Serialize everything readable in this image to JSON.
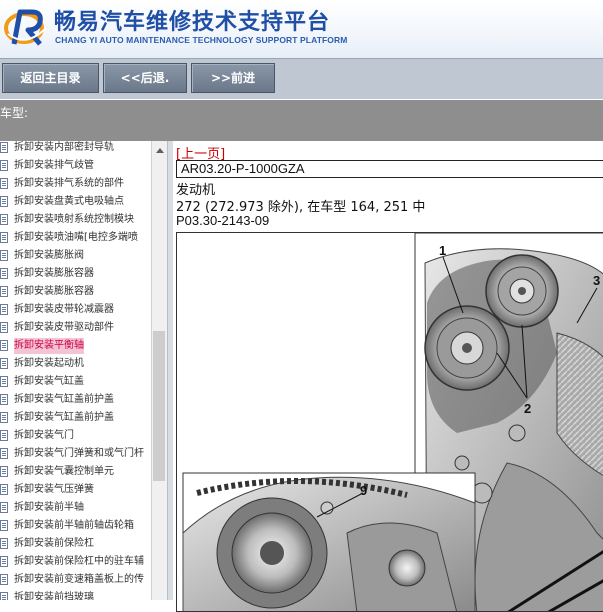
{
  "header": {
    "title_cn": "畅易汽车维修技术支持平台",
    "title_en": "CHANG YI AUTO MAINTENANCE TECHNOLOGY SUPPORT PLATFORM"
  },
  "toolbar": {
    "home_label": "返回主目录",
    "back_label": "<<后退.",
    "forward_label": ">>前进"
  },
  "model_bar": {
    "label": "车型:"
  },
  "tree": {
    "items": [
      {
        "label": "拆卸安装内部密封导轨",
        "selected": false
      },
      {
        "label": "拆卸安装排气歧管",
        "selected": false
      },
      {
        "label": "拆卸安装排气系统的部件",
        "selected": false
      },
      {
        "label": "拆卸安装盘黄式电吸轴点",
        "selected": false
      },
      {
        "label": "拆卸安装喷射系统控制模块",
        "selected": false
      },
      {
        "label": "拆卸安装喷油嘴[电控多端喷",
        "selected": false
      },
      {
        "label": "拆卸安装膨胀阀",
        "selected": false
      },
      {
        "label": "拆卸安装膨胀容器",
        "selected": false
      },
      {
        "label": "拆卸安装膨胀容器",
        "selected": false
      },
      {
        "label": "拆卸安装皮带轮减震器",
        "selected": false
      },
      {
        "label": "拆卸安装皮带驱动部件",
        "selected": false
      },
      {
        "label": "拆卸安装平衡轴",
        "selected": true
      },
      {
        "label": "拆卸安装起动机",
        "selected": false
      },
      {
        "label": "拆卸安装气缸盖",
        "selected": false
      },
      {
        "label": "拆卸安装气缸盖前护盖",
        "selected": false
      },
      {
        "label": "拆卸安装气缸盖前护盖",
        "selected": false
      },
      {
        "label": "拆卸安装气门",
        "selected": false
      },
      {
        "label": "拆卸安装气门弹簧和或气门杆",
        "selected": false
      },
      {
        "label": "拆卸安装气囊控制单元",
        "selected": false
      },
      {
        "label": "拆卸安装气压弹簧",
        "selected": false
      },
      {
        "label": "拆卸安装前半轴",
        "selected": false
      },
      {
        "label": "拆卸安装前半轴前轴齿轮箱",
        "selected": false
      },
      {
        "label": "拆卸安装前保险杠",
        "selected": false
      },
      {
        "label": "拆卸安装前保险杠中的驻车辅",
        "selected": false
      },
      {
        "label": "拆卸安装前变速箱盖板上的传",
        "selected": false
      },
      {
        "label": "拆卸安装前挡玻璃",
        "selected": false
      }
    ]
  },
  "content": {
    "prev_link": "[上一页]",
    "doc_code": "AR03.20-P-1000GZA",
    "section": "发动机",
    "note": "272 (272.973 除外), 在车型 164, 251 中",
    "figure_code": "P03.30-2143-09",
    "callouts": [
      "1",
      "2",
      "3",
      "9"
    ]
  },
  "colors": {
    "title_blue": "#1f4fa6",
    "toolbar_bg": "#bfc7d2",
    "button_bg": "#7a8799",
    "model_bar_bg": "#8e8e8e",
    "link_red": "#cc0000",
    "selected_bg": "#f4c4d4"
  }
}
